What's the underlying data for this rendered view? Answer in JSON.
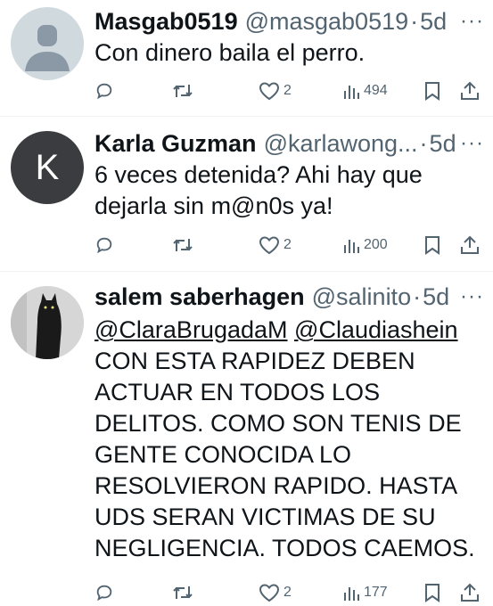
{
  "colors": {
    "text": "#0f1419",
    "secondary": "#536471",
    "divider": "#eff3f4"
  },
  "icons": {
    "reply": "reply-icon",
    "repost": "repost-icon",
    "like": "heart-icon",
    "views": "views-icon",
    "bookmark": "bookmark-icon",
    "share": "share-icon",
    "more": "more-icon"
  },
  "tweets": [
    {
      "name": "Masgab0519",
      "handle": "@masgab0519",
      "dot": "·",
      "time": "5d",
      "more": "···",
      "text": "Con dinero baila el perro.",
      "likes": "2",
      "views": "494"
    },
    {
      "name": "Karla Guzman",
      "handle": "@karlawong...",
      "dot": "·",
      "time": "5d",
      "more": "···",
      "avatar_initial": "K",
      "text_lines": [
        "6 veces detenida? Ahi hay que",
        "dejarla sin m@n0s ya!"
      ],
      "likes": "2",
      "views": "200"
    },
    {
      "name": "salem saberhagen",
      "handle": "@salinito",
      "dot": "·",
      "time": "5d",
      "more": "···",
      "mentions": [
        "@ClaraBrugadaM",
        "@Claudiashein"
      ],
      "text_lines": [
        "CON ESTA RAPIDEZ DEBEN",
        "ACTUAR EN TODOS LOS",
        "DELITOS. COMO SON TENIS DE",
        "GENTE CONOCIDA LO",
        "RESOLVIERON RAPIDO. HASTA",
        "UDS SERAN VICTIMAS DE SU",
        "NEGLIGENCIA. TODOS CAEMOS."
      ],
      "likes": "2",
      "views": "177"
    }
  ]
}
